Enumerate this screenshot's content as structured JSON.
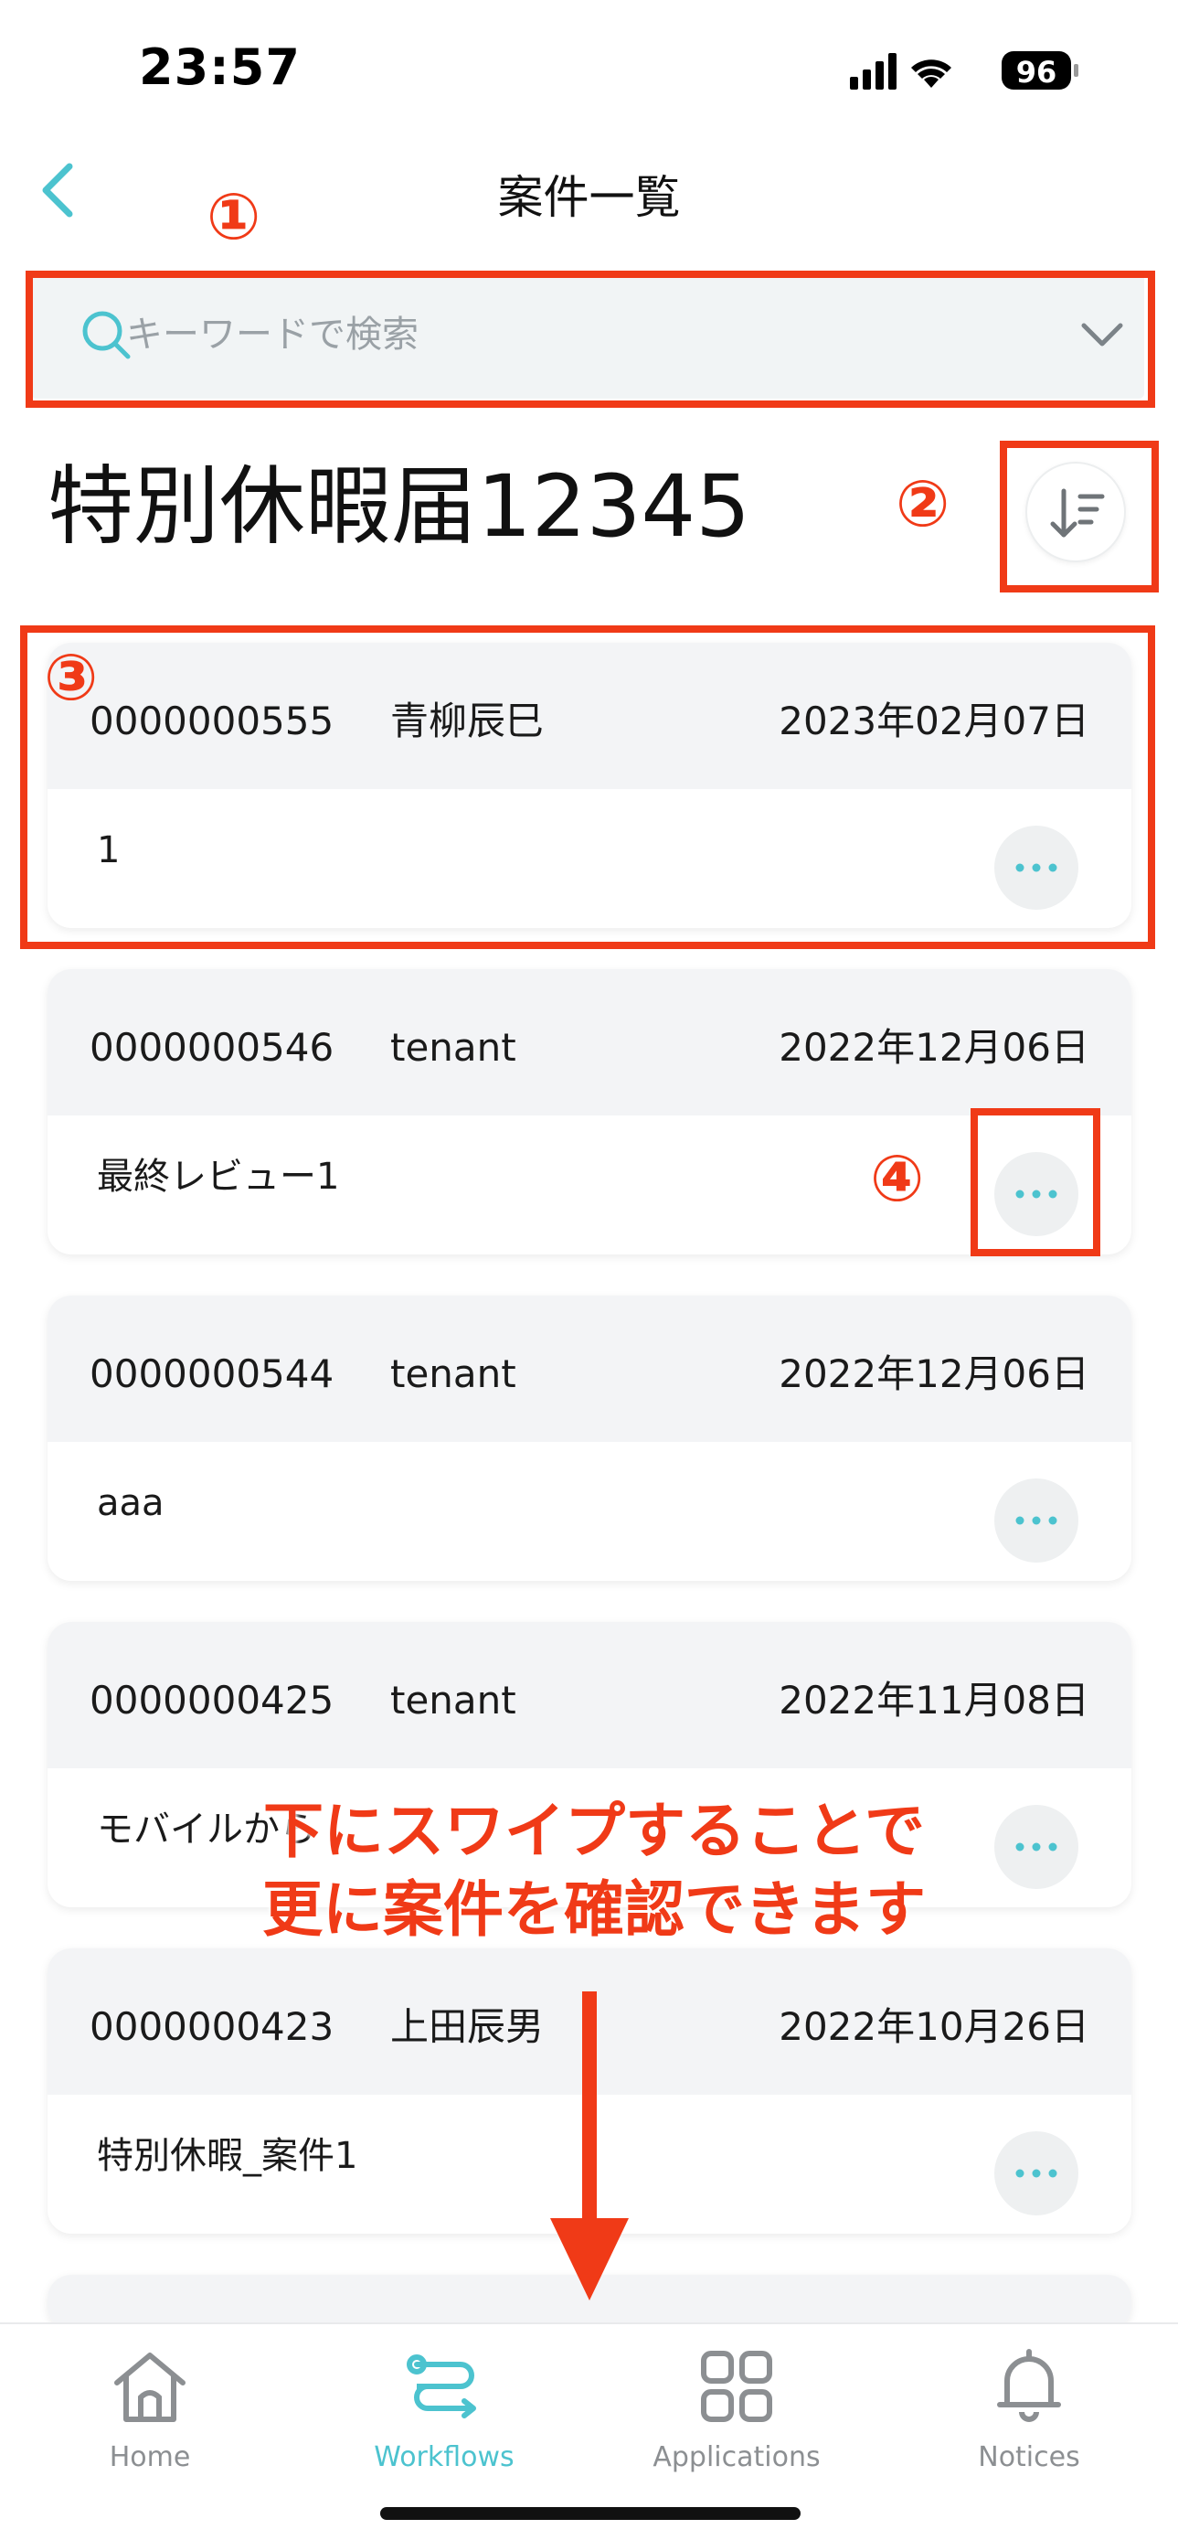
{
  "status_bar": {
    "time": "23:57",
    "battery": "96"
  },
  "nav": {
    "title": "案件一覧"
  },
  "search": {
    "placeholder": "キーワードで検索"
  },
  "list": {
    "heading": "特別休暇届12345",
    "items": [
      {
        "id": "0000000555",
        "user": "青柳辰巳",
        "date": "2023年02月07日",
        "title": "1"
      },
      {
        "id": "0000000546",
        "user": "tenant",
        "date": "2022年12月06日",
        "title": "最終レビュー1"
      },
      {
        "id": "0000000544",
        "user": "tenant",
        "date": "2022年12月06日",
        "title": "aaa"
      },
      {
        "id": "0000000425",
        "user": "tenant",
        "date": "2022年11月08日",
        "title": "モバイルから"
      },
      {
        "id": "0000000423",
        "user": "上田辰男",
        "date": "2022年10月26日",
        "title": "特別休暇_案件1"
      }
    ]
  },
  "tabs": [
    {
      "label": "Home",
      "icon": "home-icon",
      "active": false
    },
    {
      "label": "Workflows",
      "icon": "workflows-icon",
      "active": true
    },
    {
      "label": "Applications",
      "icon": "applications-grid-icon",
      "active": false
    },
    {
      "label": "Notices",
      "icon": "bell-icon",
      "active": false
    }
  ],
  "annotations": {
    "n1": "①",
    "n2": "②",
    "n3": "③",
    "n4": "④",
    "swipe_line1": "下にスワイプすることで",
    "swipe_line2": "更に案件を確認できます"
  },
  "colors": {
    "accent": "#4cc3cf",
    "annotation": "#f03a17",
    "card_header": "#f3f4f6"
  }
}
